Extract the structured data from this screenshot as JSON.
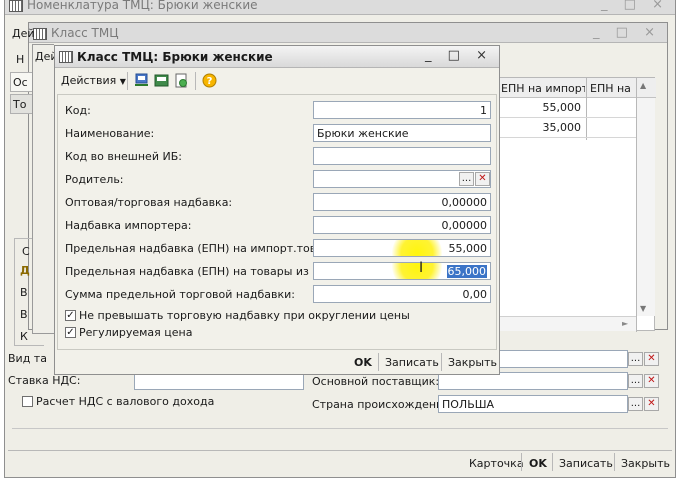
{
  "bg_window": {
    "title": "Номенклатура ТМЦ: Брюки женские"
  },
  "mid_window": {
    "title": "Класс ТМЦ",
    "tab_clip": "Дей",
    "h_clip": "Н",
    "left_clips": [
      "Ос",
      "То"
    ],
    "table": {
      "col1": "ЕПН на импорт. ...",
      "col2": "ЕПН на т",
      "rows": [
        {
          "v1": "55,000"
        },
        {
          "v1": "35,000"
        }
      ]
    },
    "side_clips": [
      "С",
      "Д",
      "В",
      "В",
      "К"
    ]
  },
  "third_clip": "Дей",
  "bg_fields": {
    "vid_label": "Вид та",
    "nds_label": "Ставка НДС:",
    "supplier_label": "Основной поставщик:",
    "calc_label": "Расчет НДС с валового дохода",
    "origin_label": "Страна происхождения:",
    "origin_value": "ПОЛЬША"
  },
  "bottom_bar": {
    "card": "Карточка",
    "ok": "OK",
    "save": "Записать",
    "save_close": "Закрыть"
  },
  "dialog": {
    "title": "Класс ТМЦ: Брюки женские",
    "actions_label": "Действия",
    "fields": [
      {
        "label": "Код:",
        "value": "1"
      },
      {
        "label": "Наименование:",
        "value": "Брюки женские"
      },
      {
        "label": "Код во внешней ИБ:",
        "value": ""
      },
      {
        "label": "Родитель:",
        "value": ""
      },
      {
        "label": "Оптовая/торговая надбавка:",
        "value": "0,00000"
      },
      {
        "label": "Надбавка импортера:",
        "value": "0,00000"
      },
      {
        "label": "Предельная надбавка (ЕПН) на импорт.товары:",
        "value": "55,000"
      },
      {
        "label": "Предельная надбавка (ЕПН) на товары из РБ:",
        "value": "65,000"
      },
      {
        "label": "Сумма предельной торговой надбавки:",
        "value": "0,00"
      }
    ],
    "checkboxes": [
      {
        "label": "Не превышать торговую надбавку при округлении цены",
        "checked": true
      },
      {
        "label": "Регулируемая цена",
        "checked": true
      }
    ],
    "footer": {
      "ok": "OK",
      "save": "Записать",
      "close": "Закрыть"
    }
  }
}
